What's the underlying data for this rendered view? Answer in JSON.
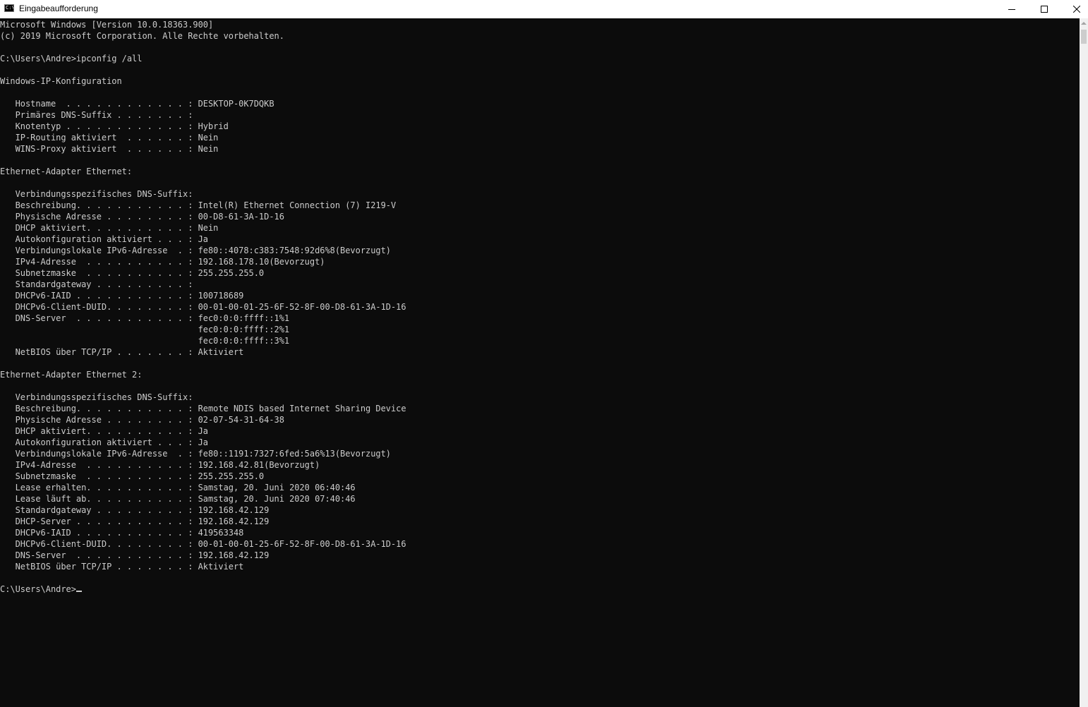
{
  "window": {
    "title": "Eingabeaufforderung",
    "icon": "cmd-icon",
    "controls": {
      "minimize": "minimize-icon",
      "maximize": "maximize-icon",
      "close": "close-icon"
    }
  },
  "console": {
    "lines": [
      "Microsoft Windows [Version 10.0.18363.900]",
      "(c) 2019 Microsoft Corporation. Alle Rechte vorbehalten.",
      "",
      "C:\\Users\\Andre>ipconfig /all",
      "",
      "Windows-IP-Konfiguration",
      "",
      "   Hostname  . . . . . . . . . . . . : DESKTOP-0K7DQKB",
      "   Primäres DNS-Suffix . . . . . . . :",
      "   Knotentyp . . . . . . . . . . . . : Hybrid",
      "   IP-Routing aktiviert  . . . . . . : Nein",
      "   WINS-Proxy aktiviert  . . . . . . : Nein",
      "",
      "Ethernet-Adapter Ethernet:",
      "",
      "   Verbindungsspezifisches DNS-Suffix:",
      "   Beschreibung. . . . . . . . . . . : Intel(R) Ethernet Connection (7) I219-V",
      "   Physische Adresse . . . . . . . . : 00-D8-61-3A-1D-16",
      "   DHCP aktiviert. . . . . . . . . . : Nein",
      "   Autokonfiguration aktiviert . . . : Ja",
      "   Verbindungslokale IPv6-Adresse  . : fe80::4078:c383:7548:92d6%8(Bevorzugt)",
      "   IPv4-Adresse  . . . . . . . . . . : 192.168.178.10(Bevorzugt)",
      "   Subnetzmaske  . . . . . . . . . . : 255.255.255.0",
      "   Standardgateway . . . . . . . . . :",
      "   DHCPv6-IAID . . . . . . . . . . . : 100718689",
      "   DHCPv6-Client-DUID. . . . . . . . : 00-01-00-01-25-6F-52-8F-00-D8-61-3A-1D-16",
      "   DNS-Server  . . . . . . . . . . . : fec0:0:0:ffff::1%1",
      "                                       fec0:0:0:ffff::2%1",
      "                                       fec0:0:0:ffff::3%1",
      "   NetBIOS über TCP/IP . . . . . . . : Aktiviert",
      "",
      "Ethernet-Adapter Ethernet 2:",
      "",
      "   Verbindungsspezifisches DNS-Suffix:",
      "   Beschreibung. . . . . . . . . . . : Remote NDIS based Internet Sharing Device",
      "   Physische Adresse . . . . . . . . : 02-07-54-31-64-38",
      "   DHCP aktiviert. . . . . . . . . . : Ja",
      "   Autokonfiguration aktiviert . . . : Ja",
      "   Verbindungslokale IPv6-Adresse  . : fe80::1191:7327:6fed:5a6%13(Bevorzugt)",
      "   IPv4-Adresse  . . . . . . . . . . : 192.168.42.81(Bevorzugt)",
      "   Subnetzmaske  . . . . . . . . . . : 255.255.255.0",
      "   Lease erhalten. . . . . . . . . . : Samstag, 20. Juni 2020 06:40:46",
      "   Lease läuft ab. . . . . . . . . . : Samstag, 20. Juni 2020 07:40:46",
      "   Standardgateway . . . . . . . . . : 192.168.42.129",
      "   DHCP-Server . . . . . . . . . . . : 192.168.42.129",
      "   DHCPv6-IAID . . . . . . . . . . . : 419563348",
      "   DHCPv6-Client-DUID. . . . . . . . : 00-01-00-01-25-6F-52-8F-00-D8-61-3A-1D-16",
      "   DNS-Server  . . . . . . . . . . . : 192.168.42.129",
      "   NetBIOS über TCP/IP . . . . . . . : Aktiviert",
      "",
      "C:\\Users\\Andre>"
    ]
  },
  "colors": {
    "console_background": "#0c0c0c",
    "console_text": "#cccccc",
    "titlebar_background": "#ffffff"
  }
}
